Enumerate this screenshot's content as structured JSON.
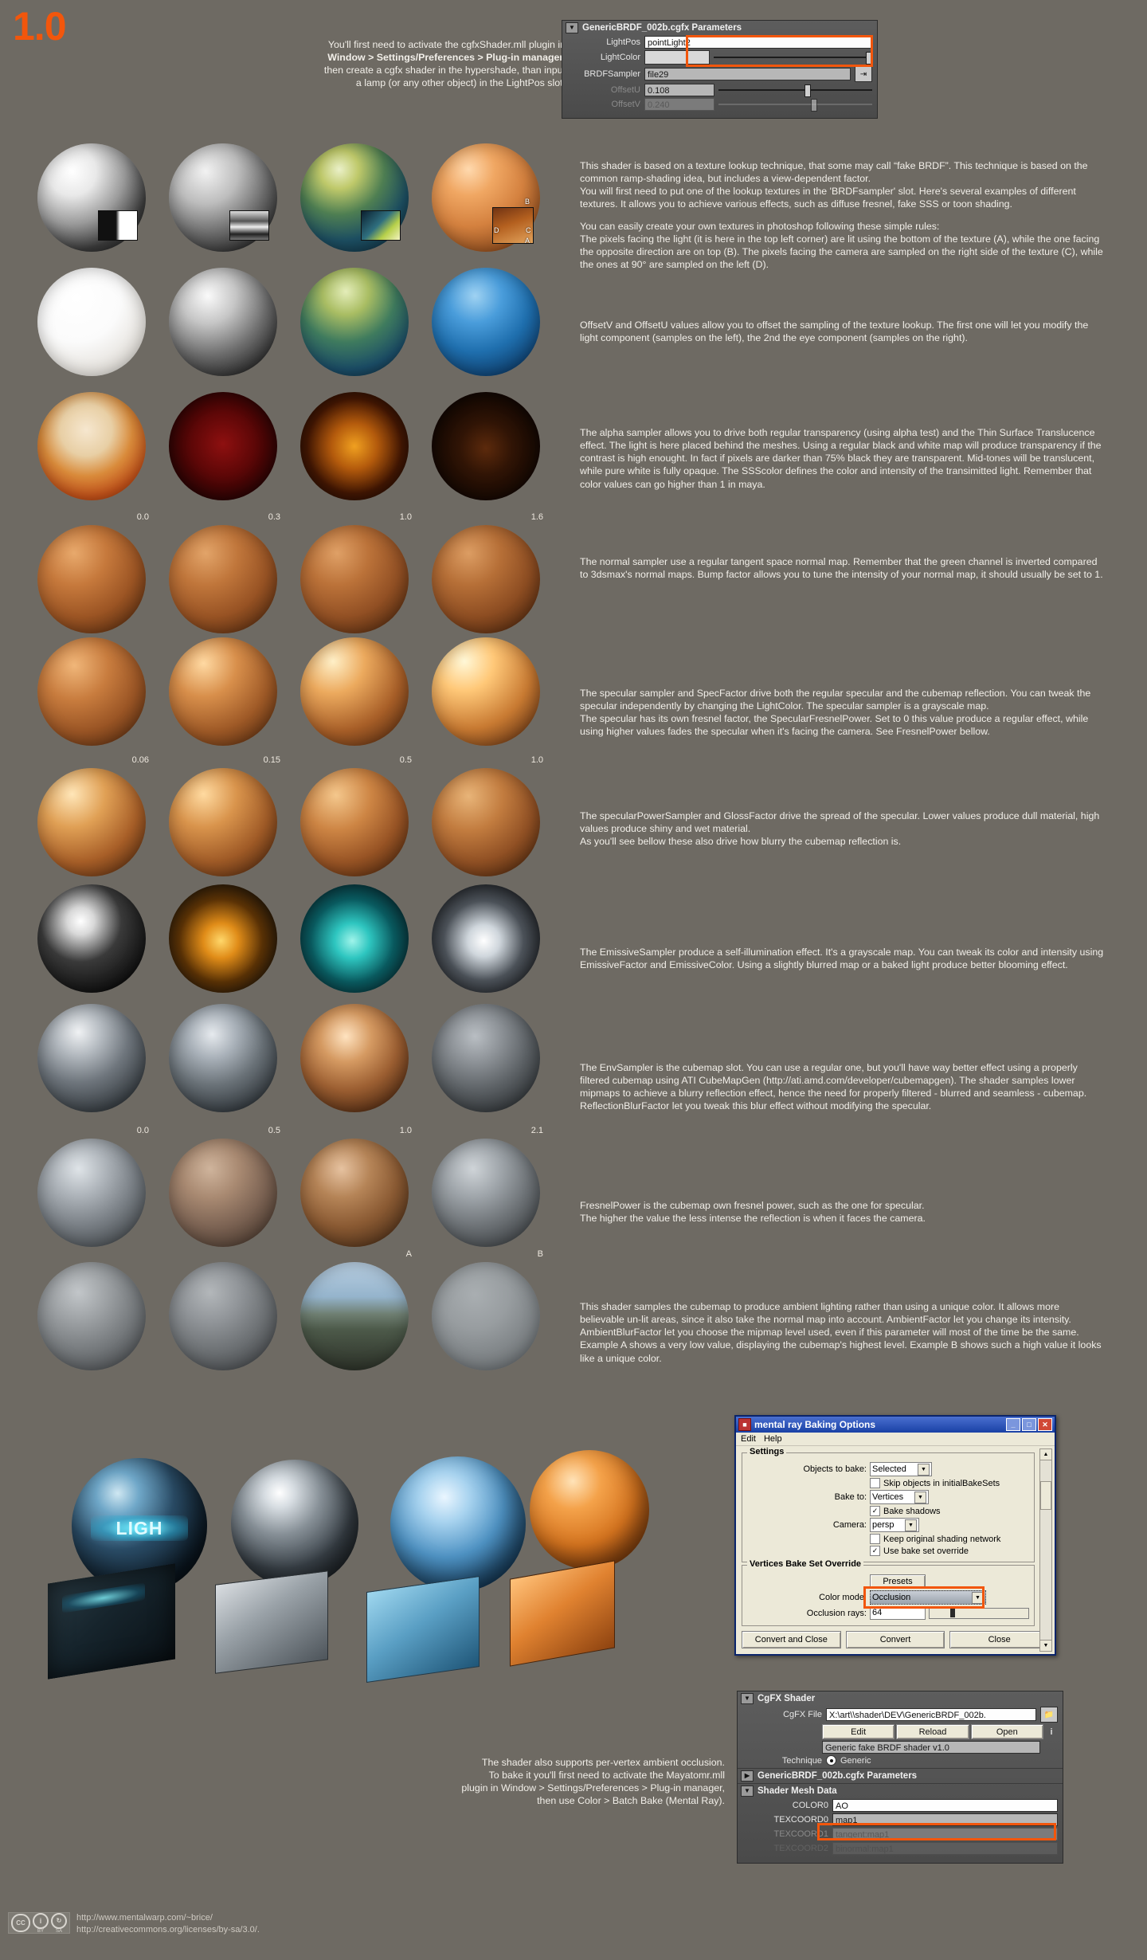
{
  "version_label": "1.0",
  "intro_note": {
    "line1": "You'll first need to activate the cgfxShader.mll plugin in",
    "line2": "Window > Settings/Preferences > Plug-in manager,",
    "line3": "then create a cgfx shader in the hypershade,  than input",
    "line4": "a lamp (or any other object) in the LightPos slot."
  },
  "top_panel": {
    "title": "GenericBRDF_002b.cgfx Parameters",
    "collapse_icon": "chevron-down-icon",
    "rows": [
      {
        "label": "LightPos",
        "value": "pointLight2",
        "type": "text"
      },
      {
        "label": "LightColor",
        "value": "",
        "type": "color"
      },
      {
        "label": "BRDFSampler",
        "value": "file29",
        "type": "texture"
      },
      {
        "label": "OffsetU",
        "value": "0.108",
        "type": "slider"
      },
      {
        "label": "OffsetV",
        "value": "0.240",
        "type": "slider"
      }
    ]
  },
  "sections": [
    {
      "id": "brdf-sampler",
      "labels": [
        "",
        "",
        "",
        ""
      ],
      "corner_tags": [
        "D",
        "B",
        "C",
        "A"
      ],
      "text": [
        "This shader is based on a texture lookup technique, that some may call “fake BRDF”. This technique is based on the common ramp-shading idea, but includes a view-dependent factor.",
        "You will first need to put one of the lookup textures in the 'BRDFsampler' slot. Here's several examples of different textures. It allows you to achieve various effects, such as diffuse fresnel, fake SSS or toon shading.",
        "",
        "You can easily create your own textures in photoshop following these simple rules:",
        "The pixels facing the light (it is here in the top left corner) are lit using the bottom of the texture (A), while the one facing the opposite direction are on top (B). The pixels facing the camera are sampled on the right side of the texture (C), while the ones at 90° are sampled on the left (D)."
      ]
    },
    {
      "id": "offset-uv",
      "labels": [
        "",
        "",
        "",
        ""
      ],
      "text": [
        "OffsetV and OffsetU values allow you to offset the sampling of the texture lookup. The first one will let you modify the light component (samples on the left), the 2nd the eye component (samples on the right)."
      ]
    },
    {
      "id": "alpha-sampler",
      "labels": [
        "",
        "",
        "",
        ""
      ],
      "text": [
        "The alpha sampler allows you to drive both regular transparency (using alpha test) and the Thin Surface Translucence effect. The light is here placed behind the meshes. Using a regular black and white map will produce transparency if the contrast is high enought. In fact if pixels are darker than 75% black they are transparent. Mid-tones will be translucent, while pure white is fully opaque. The SSScolor defines the color and intensity of the transimitted light. Remember that color values can go higher than 1 in maya."
      ]
    },
    {
      "id": "normal-sampler",
      "labels": [
        "0.0",
        "0.3",
        "1.0",
        "1.6"
      ],
      "text": [
        "The normal sampler use a regular tangent space normal map. Remember that the green channel is inverted compared to 3dsmax's normal maps. Bump factor allows you to tune the intensity of your normal map, it should usually be set to 1."
      ]
    },
    {
      "id": "specular-sampler",
      "labels": [
        "",
        "",
        "",
        ""
      ],
      "text": [
        "The specular sampler and SpecFactor drive both the regular specular and the cubemap reflection. You can tweak the specular independently by changing the LightColor. The specular sampler is a grayscale map.",
        "The specular has its own fresnel factor, the SpecularFresnelPower. Set to 0 this value produce a regular effect, while using higher values fades the specular when it's facing the camera. See FresnelPower bellow."
      ]
    },
    {
      "id": "specular-power",
      "labels": [
        "0.06",
        "0.15",
        "0.5",
        "1.0"
      ],
      "text": [
        "The specularPowerSampler and GlossFactor drive the spread of the specular. Lower values produce dull material, high values produce shiny and wet material.",
        "As you'll see bellow these also drive how blurry the cubemap reflection is."
      ]
    },
    {
      "id": "emissive-sampler",
      "labels": [
        "",
        "",
        "",
        ""
      ],
      "text": [
        "The EmissiveSampler produce a self-illumination effect. It's a grayscale map. You can tweak its color and intensity using EmissiveFactor and EmissiveColor. Using a slightly blurred map or a baked light produce better blooming effect."
      ]
    },
    {
      "id": "env-sampler",
      "labels": [
        "",
        "",
        "",
        ""
      ],
      "text": [
        "The EnvSampler is the cubemap slot. You can use a regular one, but you'll have way better effect using a properly filtered cubemap using ATI CubeMapGen (http://ati.amd.com/developer/cubemapgen). The shader samples lower mipmaps to achieve a blurry reflection effect, hence the need for properly filtered - blurred and seamless - cubemap. ReflectionBlurFactor let you tweak this blur effect without modifying the specular."
      ]
    },
    {
      "id": "fresnel-power",
      "labels": [
        "0.0",
        "0.5",
        "1.0",
        "2.1"
      ],
      "text": [
        "FresnelPower is the cubemap own fresnel power, such as the one for specular.",
        "The higher the value the less intense the reflection is when it faces the camera."
      ]
    },
    {
      "id": "ambient-factor",
      "labels": [
        "",
        "",
        "A",
        "B"
      ],
      "text": [
        "This shader samples the cubemap to produce ambient lighting rather than using a unique color. It allows more believable un-lit areas, since it also take the normal map into account. AmbientFactor let you change its intensity. AmbientBlurFactor let you choose the mipmap level used, even if this parameter will most of the time be the same. Example A shows a very low value, displaying the cubemap's highest level. Example B shows such a high value it looks like a unique color."
      ]
    }
  ],
  "ao_note": {
    "line1": "The  shader also supports per-vertex ambient occlusion.",
    "line2": "To bake it you'll first need to activate the Mayatomr.mll",
    "line3": "plugin in Window > Settings/Preferences > Plug-in manager,",
    "line4": "then use Color > Batch Bake (Mental Ray)."
  },
  "baking_dialog": {
    "title": "mental ray Baking Options",
    "app_icon": "maya-icon",
    "menu": [
      "Edit",
      "Help"
    ],
    "minimize_icon": "minimize-icon",
    "maximize_icon": "maximize-icon",
    "close_icon": "close-icon",
    "settings_group": {
      "legend": "Settings",
      "objects_to_bake_label": "Objects to bake:",
      "objects_to_bake_value": "Selected",
      "skip_objects_label": "Skip objects in initialBakeSets",
      "skip_objects_checked": false,
      "bake_to_label": "Bake to:",
      "bake_to_value": "Vertices",
      "bake_shadows_label": "Bake shadows",
      "bake_shadows_checked": true,
      "camera_label": "Camera:",
      "camera_value": "persp",
      "keep_original_label": "Keep original shading network",
      "keep_original_checked": false,
      "use_bake_set_label": "Use bake set override",
      "use_bake_set_checked": true
    },
    "override_group": {
      "legend": "Vertices Bake Set Override",
      "presets_label": "Presets",
      "color_mode_label": "Color mode:",
      "color_mode_value": "Occlusion",
      "occlusion_rays_label": "Occlusion rays:",
      "occlusion_rays_value": "64"
    },
    "buttons": [
      "Convert and Close",
      "Convert",
      "Close"
    ]
  },
  "cgfx_panel": {
    "shader_section_title": "CgFX Shader",
    "file_label": "CgFX File",
    "file_value": "X:\\art\\\\shader\\DEV\\GenericBRDF_002b.",
    "folder_icon": "folder-icon",
    "buttons": [
      "Edit",
      "Reload",
      "Open"
    ],
    "info_icon": "info-icon",
    "description": "Generic fake BRDF shader v1.0",
    "technique_label": "Technique",
    "technique_value": "Generic",
    "params_section_title": "GenericBRDF_002b.cgfx Parameters",
    "mesh_section_title": "Shader Mesh Data",
    "mesh_rows": [
      {
        "label": "COLOR0",
        "value": "AO",
        "dim": false
      },
      {
        "label": "TEXCOORD0",
        "value": "map1",
        "dim": false
      },
      {
        "label": "TEXCOORD1",
        "value": "tangent:map1",
        "dim": true
      },
      {
        "label": "TEXCOORD2",
        "value": "binormal:map1",
        "dim": true
      }
    ]
  },
  "footer": {
    "cc_label": "CC",
    "by_label": "BY",
    "sa_label": "SA",
    "by_glyph": "i",
    "sa_glyph": "⓪",
    "link1": "http://www.mentalwarp.com/~brice/",
    "link2": "http://creativecommons.org/licenses/by-sa/3.0/."
  },
  "colors": {
    "background": "#6e6a63",
    "accent_orange": "#f2560c",
    "text": "#f2efe9"
  }
}
